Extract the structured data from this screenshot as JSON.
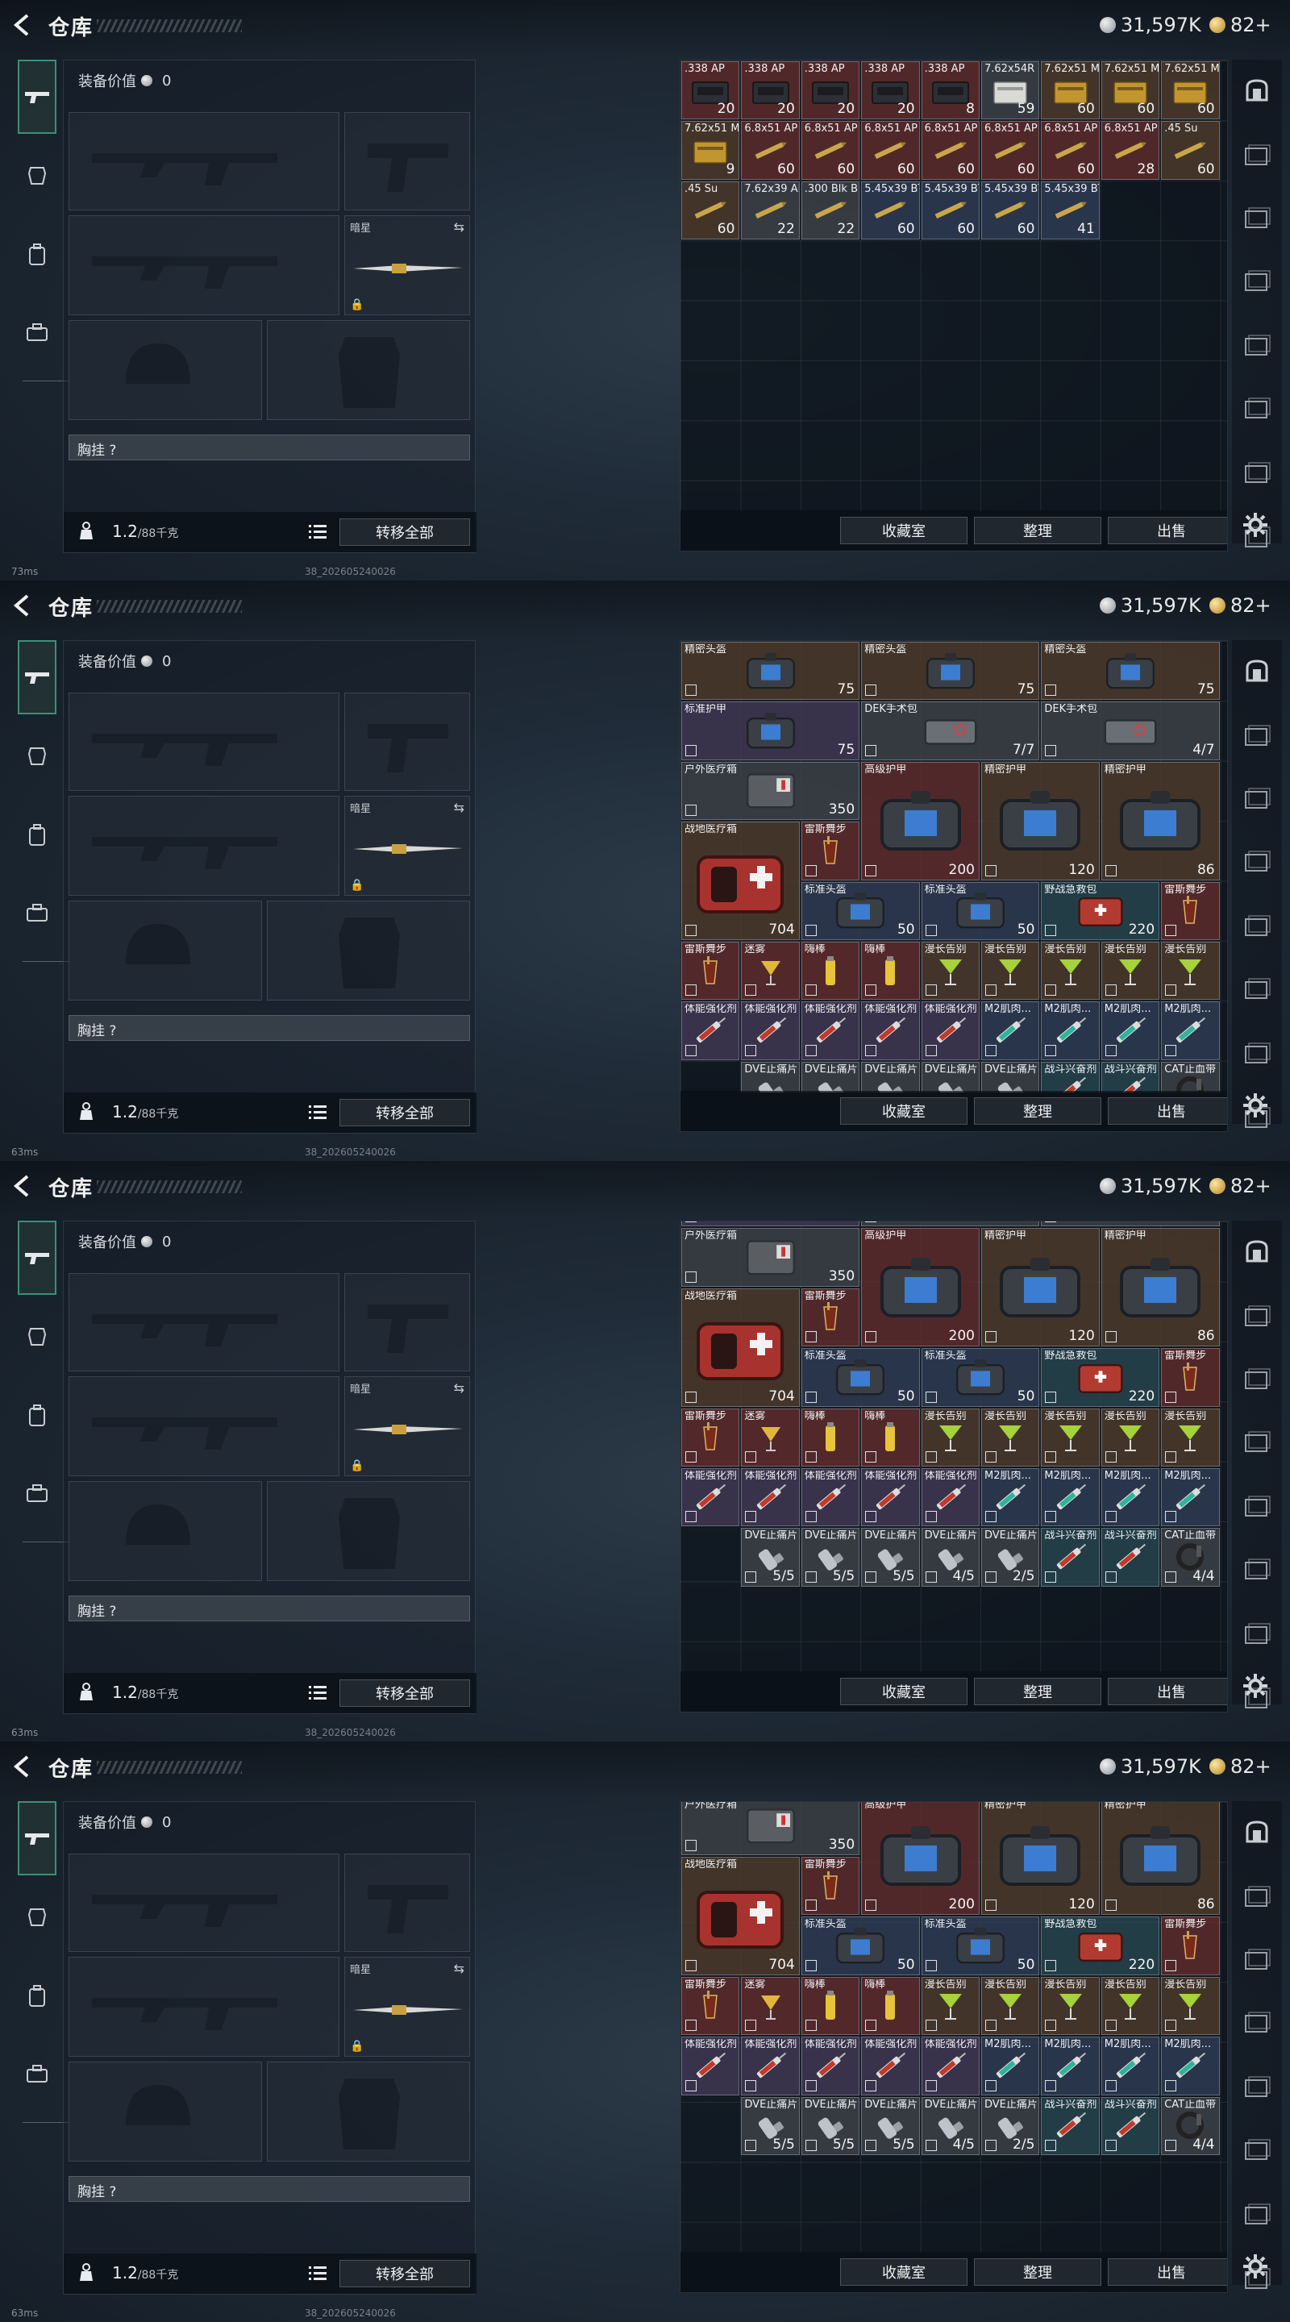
{
  "title": "仓库",
  "currency": {
    "silver": "31,597K",
    "gold": "82+"
  },
  "loadout": {
    "value_label": "装备价值",
    "value": "0",
    "slot_name": "暗星",
    "chest_label": "胸挂 ?",
    "weight": "1.2",
    "weight_max": "/88千克",
    "transfer_label": "转移全部"
  },
  "stash_buttons": {
    "collection": "收藏室",
    "organize": "整理",
    "sell": "出售"
  },
  "frames": [
    {
      "ping": "73ms",
      "build": "38_202605240026"
    },
    {
      "ping": "63ms",
      "build": "38_202605240026"
    },
    {
      "ping": "63ms",
      "build": "38_202605240026"
    },
    {
      "ping": "63ms",
      "build": "38_202605240026"
    }
  ],
  "ammo_items": [
    {
      "name": ".338 AP",
      "count": "20"
    },
    {
      "name": ".338 AP",
      "count": "20"
    },
    {
      "name": ".338 AP",
      "count": "20"
    },
    {
      "name": ".338 AP",
      "count": "20"
    },
    {
      "name": ".338 AP",
      "count": "8"
    },
    {
      "name": "7.62x54R",
      "count": "59"
    },
    {
      "name": "7.62x51 M",
      "count": "60"
    },
    {
      "name": "7.62x51 M",
      "count": "60"
    },
    {
      "name": "7.62x51 M",
      "count": "60"
    },
    {
      "name": "7.62x51 M",
      "count": "9"
    },
    {
      "name": "6.8x51 AP",
      "count": "60"
    },
    {
      "name": "6.8x51 AP",
      "count": "60"
    },
    {
      "name": "6.8x51 AP",
      "count": "60"
    },
    {
      "name": "6.8x51 AP",
      "count": "60"
    },
    {
      "name": "6.8x51 AP",
      "count": "60"
    },
    {
      "name": "6.8x51 AP",
      "count": "60"
    },
    {
      "name": "6.8x51 AP",
      "count": "28"
    },
    {
      "name": ".45 Su",
      "count": "60"
    },
    {
      "name": ".45 Su",
      "count": "60"
    },
    {
      "name": "7.62x39 AP",
      "count": "22"
    },
    {
      "name": ".300 Blk BP",
      "count": "22"
    },
    {
      "name": "5.45x39 BT",
      "count": "60"
    },
    {
      "name": "5.45x39 BT",
      "count": "60"
    },
    {
      "name": "5.45x39 BT",
      "count": "60"
    },
    {
      "name": "5.45x39 BT",
      "count": "41"
    }
  ],
  "gear_items": [
    {
      "name": "精密头盔",
      "count": "75",
      "bg": "bg-brown",
      "w": 3,
      "h": 1,
      "icon": "helmet-case"
    },
    {
      "name": "精密头盔",
      "count": "75",
      "bg": "bg-brown",
      "w": 3,
      "h": 1,
      "icon": "helmet-case"
    },
    {
      "name": "精密头盔",
      "count": "75",
      "bg": "bg-brown",
      "w": 3,
      "h": 1,
      "icon": "helmet-case"
    },
    {
      "name": "标准护甲",
      "count": "75",
      "bg": "bg-pur",
      "w": 3,
      "h": 1,
      "icon": "armor-case"
    },
    {
      "name": "DEK手术包",
      "count": "7/7",
      "bg": "bg-gray",
      "w": 3,
      "h": 1,
      "icon": "surgery-kit"
    },
    {
      "name": "DEK手术包",
      "count": "4/7",
      "bg": "bg-gray",
      "w": 3,
      "h": 1,
      "icon": "surgery-kit"
    },
    {
      "name": "户外医疗箱",
      "count": "350",
      "bg": "bg-gray",
      "w": 3,
      "h": 1,
      "icon": "med-box"
    },
    {
      "name": "高级护甲",
      "count": "200",
      "bg": "bg-red",
      "w": 2,
      "h": 2,
      "icon": "armor-case"
    },
    {
      "name": "精密护甲",
      "count": "120",
      "bg": "bg-brown",
      "w": 2,
      "h": 2,
      "icon": "armor-case"
    },
    {
      "name": "精密护甲",
      "count": "86",
      "bg": "bg-brown",
      "w": 2,
      "h": 2,
      "icon": "armor-case"
    },
    {
      "name": "战地医疗箱",
      "count": "704",
      "bg": "bg-brown",
      "w": 2,
      "h": 2,
      "icon": "med-kit"
    },
    {
      "name": "雷斯舞步",
      "count": "",
      "bg": "bg-red",
      "w": 1,
      "h": 1,
      "icon": "drink"
    },
    {
      "name": "标准头盔",
      "count": "50",
      "bg": "bg-blue",
      "w": 2,
      "h": 1,
      "icon": "helmet-case"
    },
    {
      "name": "标准头盔",
      "count": "50",
      "bg": "bg-blue",
      "w": 2,
      "h": 1,
      "icon": "helmet-case"
    },
    {
      "name": "野战急救包",
      "count": "220",
      "bg": "bg-teal",
      "w": 2,
      "h": 1,
      "icon": "first-aid"
    },
    {
      "name": "雷斯舞步",
      "count": "",
      "bg": "bg-red",
      "w": 1,
      "h": 1,
      "icon": "drink"
    },
    {
      "name": "雷斯舞步",
      "count": "",
      "bg": "bg-red",
      "w": 1,
      "h": 1,
      "icon": "drink"
    },
    {
      "name": "迷雾",
      "count": "",
      "bg": "bg-red",
      "w": 1,
      "h": 1,
      "icon": "cocktail"
    },
    {
      "name": "嗨棒",
      "count": "",
      "bg": "bg-red",
      "w": 1,
      "h": 1,
      "icon": "bottle"
    },
    {
      "name": "嗨棒",
      "count": "",
      "bg": "bg-red",
      "w": 1,
      "h": 1,
      "icon": "bottle"
    },
    {
      "name": "漫长告别",
      "count": "",
      "bg": "bg-brown",
      "w": 1,
      "h": 1,
      "icon": "martini"
    },
    {
      "name": "漫长告别",
      "count": "",
      "bg": "bg-brown",
      "w": 1,
      "h": 1,
      "icon": "martini"
    },
    {
      "name": "漫长告别",
      "count": "",
      "bg": "bg-brown",
      "w": 1,
      "h": 1,
      "icon": "martini"
    },
    {
      "name": "漫长告别",
      "count": "",
      "bg": "bg-brown",
      "w": 1,
      "h": 1,
      "icon": "martini"
    },
    {
      "name": "漫长告别",
      "count": "",
      "bg": "bg-brown",
      "w": 1,
      "h": 1,
      "icon": "martini"
    },
    {
      "name": "体能强化剂",
      "count": "",
      "bg": "bg-pur",
      "w": 1,
      "h": 1,
      "icon": "syringe-red"
    },
    {
      "name": "体能强化剂",
      "count": "",
      "bg": "bg-pur",
      "w": 1,
      "h": 1,
      "icon": "syringe-red"
    },
    {
      "name": "体能强化剂",
      "count": "",
      "bg": "bg-pur",
      "w": 1,
      "h": 1,
      "icon": "syringe-red"
    },
    {
      "name": "体能强化剂",
      "count": "",
      "bg": "bg-pur",
      "w": 1,
      "h": 1,
      "icon": "syringe-red"
    },
    {
      "name": "体能强化剂",
      "count": "",
      "bg": "bg-pur",
      "w": 1,
      "h": 1,
      "icon": "syringe-red"
    },
    {
      "name": "M2肌肉...",
      "count": "",
      "bg": "bg-blue",
      "w": 1,
      "h": 1,
      "icon": "syringe-teal"
    },
    {
      "name": "M2肌肉...",
      "count": "",
      "bg": "bg-blue",
      "w": 1,
      "h": 1,
      "icon": "syringe-teal"
    },
    {
      "name": "M2肌肉...",
      "count": "",
      "bg": "bg-blue",
      "w": 1,
      "h": 1,
      "icon": "syringe-teal"
    },
    {
      "name": "M2肌肉...",
      "count": "",
      "bg": "bg-blue",
      "w": 1,
      "h": 1,
      "icon": "syringe-teal"
    },
    {
      "name": "DVE止痛片",
      "count": "5/5",
      "bg": "bg-gray",
      "w": 1,
      "h": 1,
      "icon": "inhaler"
    },
    {
      "name": "DVE止痛片",
      "count": "5/5",
      "bg": "bg-gray",
      "w": 1,
      "h": 1,
      "icon": "inhaler"
    },
    {
      "name": "DVE止痛片",
      "count": "5/5",
      "bg": "bg-gray",
      "w": 1,
      "h": 1,
      "icon": "inhaler"
    },
    {
      "name": "DVE止痛片",
      "count": "4/5",
      "bg": "bg-gray",
      "w": 1,
      "h": 1,
      "icon": "inhaler"
    },
    {
      "name": "DVE止痛片",
      "count": "2/5",
      "bg": "bg-gray",
      "w": 1,
      "h": 1,
      "icon": "inhaler"
    },
    {
      "name": "战斗兴奋剂",
      "count": "",
      "bg": "bg-teal",
      "w": 1,
      "h": 1,
      "icon": "syringe-red"
    },
    {
      "name": "战斗兴奋剂",
      "count": "",
      "bg": "bg-teal",
      "w": 1,
      "h": 1,
      "icon": "syringe-red"
    },
    {
      "name": "CAT止血带",
      "count": "4/4",
      "bg": "bg-gray",
      "w": 1,
      "h": 1,
      "icon": "tourniquet"
    }
  ]
}
